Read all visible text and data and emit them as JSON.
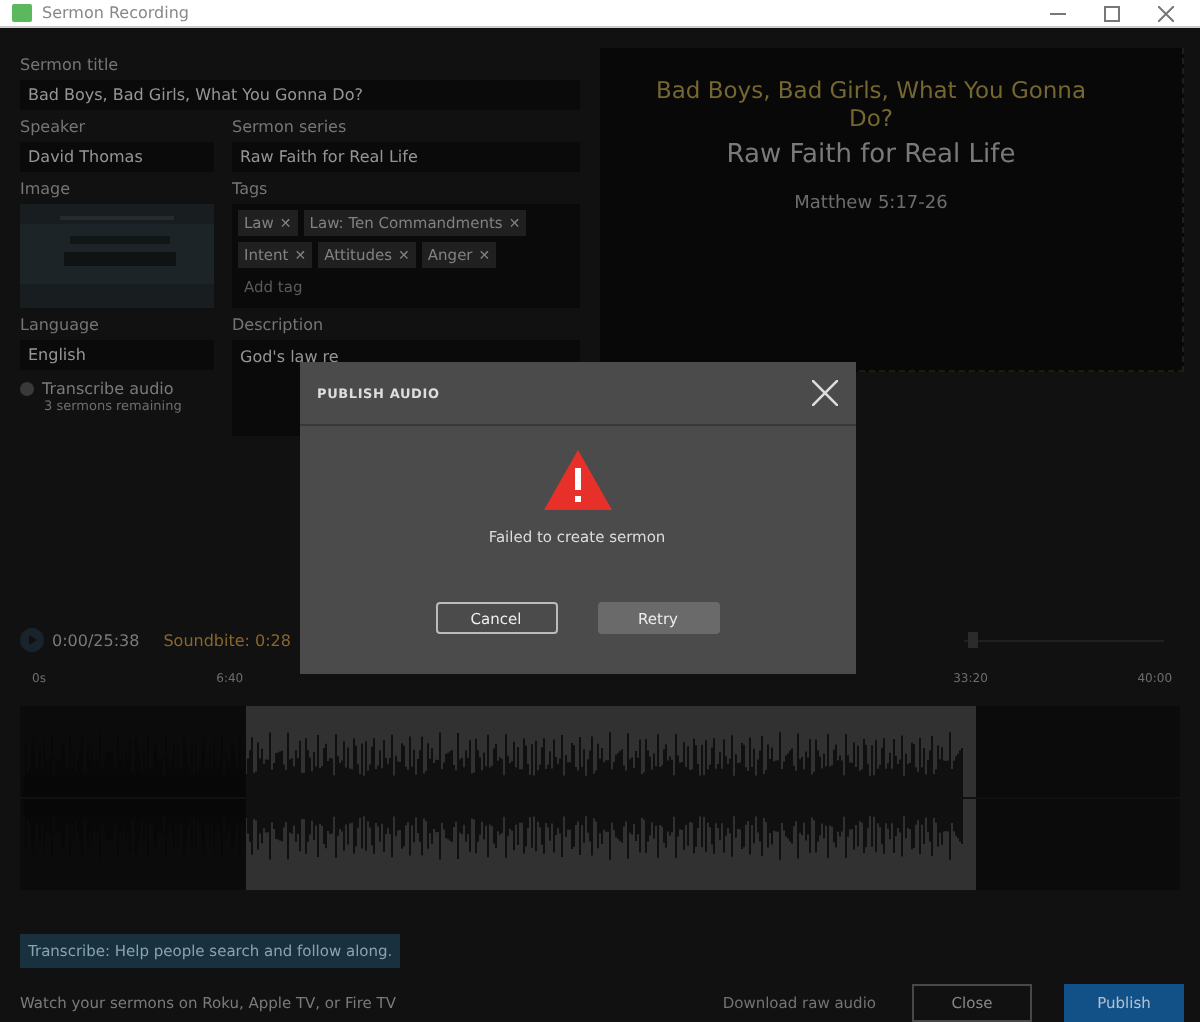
{
  "window": {
    "title": "Sermon Recording"
  },
  "form": {
    "title_label": "Sermon title",
    "title_value": "Bad Boys, Bad Girls, What You Gonna Do?",
    "speaker_label": "Speaker",
    "speaker_value": "David Thomas",
    "series_label": "Sermon series",
    "series_value": "Raw Faith for Real Life",
    "image_label": "Image",
    "tags_label": "Tags",
    "tags": [
      {
        "label": "Law",
        "remove": "✕"
      },
      {
        "label": "Law: Ten Commandments",
        "remove": "✕"
      },
      {
        "label": "Intent",
        "remove": "✕"
      },
      {
        "label": "Attitudes",
        "remove": "✕"
      },
      {
        "label": "Anger",
        "remove": "✕"
      }
    ],
    "tag_placeholder": "Add tag",
    "language_label": "Language",
    "language_value": "English",
    "description_label": "Description",
    "description_value": "God's law re",
    "transcribe_label": "Transcribe audio",
    "transcribe_checked": false,
    "remaining": "3 sermons remaining"
  },
  "preview": {
    "title": "Bad Boys, Bad Girls, What You Gonna Do?",
    "series": "Raw Faith for Real Life",
    "passage": "Matthew 5:17-26"
  },
  "player": {
    "time": "0:00",
    "duration": "/25:38",
    "soundbite": "Soundbite: 0:28",
    "zoom": {
      "level": 0.02
    },
    "ticks": [
      "0s",
      "6:40",
      "33:20",
      "40:00"
    ]
  },
  "banner": "Transcribe: Help people search and follow along.",
  "footer": {
    "note": "Watch your sermons on Roku, Apple TV, or Fire TV",
    "download": "Download raw audio",
    "close": "Close",
    "publish": "Publish"
  },
  "dialog": {
    "title": "PUBLISH AUDIO",
    "message": "Failed to create sermon",
    "buttons": [
      {
        "label": "Cancel",
        "kind": "secondary"
      },
      {
        "label": "Retry",
        "kind": "primary"
      }
    ]
  }
}
